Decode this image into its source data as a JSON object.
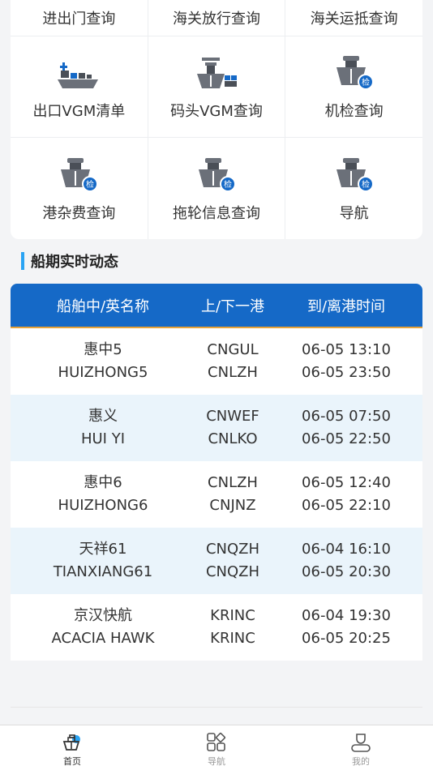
{
  "grid": {
    "top_row": [
      {
        "label": "进出门查询",
        "icon": "gate-icon"
      },
      {
        "label": "海关放行查询",
        "icon": "customs-release-icon"
      },
      {
        "label": "海关运抵查询",
        "icon": "customs-arrival-icon"
      }
    ],
    "mid_row": [
      {
        "label": "出口VGM清单",
        "icon": "ship-cargo-icon"
      },
      {
        "label": "码头VGM查询",
        "icon": "wharf-ship-icon"
      },
      {
        "label": "机检查询",
        "icon": "ship-inspection-icon"
      }
    ],
    "bot_row": [
      {
        "label": "港杂费查询",
        "icon": "ship-inspection-icon"
      },
      {
        "label": "拖轮信息查询",
        "icon": "ship-inspection-icon"
      },
      {
        "label": "导航",
        "icon": "ship-inspection-icon"
      }
    ],
    "badge_text": "检"
  },
  "section": {
    "title": "船期实时动态"
  },
  "table": {
    "headers": [
      "船舶中/英名称",
      "上/下一港",
      "到/离港时间"
    ],
    "rows": [
      {
        "cn": "惠中5",
        "en": "HUIZHONG5",
        "prev": "CNGUL",
        "next": "CNLZH",
        "arrive": "06-05 13:10",
        "depart": "06-05 23:50"
      },
      {
        "cn": "惠义",
        "en": "HUI YI",
        "prev": "CNWEF",
        "next": "CNLKO",
        "arrive": "06-05 07:50",
        "depart": "06-05 22:50"
      },
      {
        "cn": "惠中6",
        "en": "HUIZHONG6",
        "prev": "CNLZH",
        "next": "CNJNZ",
        "arrive": "06-05 12:40",
        "depart": "06-05 22:10"
      },
      {
        "cn": "天祥61",
        "en": "TIANXIANG61",
        "prev": "CNQZH",
        "next": "CNQZH",
        "arrive": "06-04 16:10",
        "depart": "06-05 20:30"
      },
      {
        "cn": "京汉快航",
        "en": "ACACIA HAWK",
        "prev": "KRINC",
        "next": "KRINC",
        "arrive": "06-04 19:30",
        "depart": "06-05 20:25"
      }
    ]
  },
  "tabbar": {
    "items": [
      {
        "label": "首页",
        "icon": "home-ship-icon"
      },
      {
        "label": "导航",
        "icon": "navigation-grid-icon"
      },
      {
        "label": "我的",
        "icon": "user-icon"
      }
    ]
  },
  "colors": {
    "accent": "#1569c7",
    "highlight": "#2aa4f4",
    "row_alt": "#eaf4fb",
    "header_underline": "#e8a33a"
  }
}
